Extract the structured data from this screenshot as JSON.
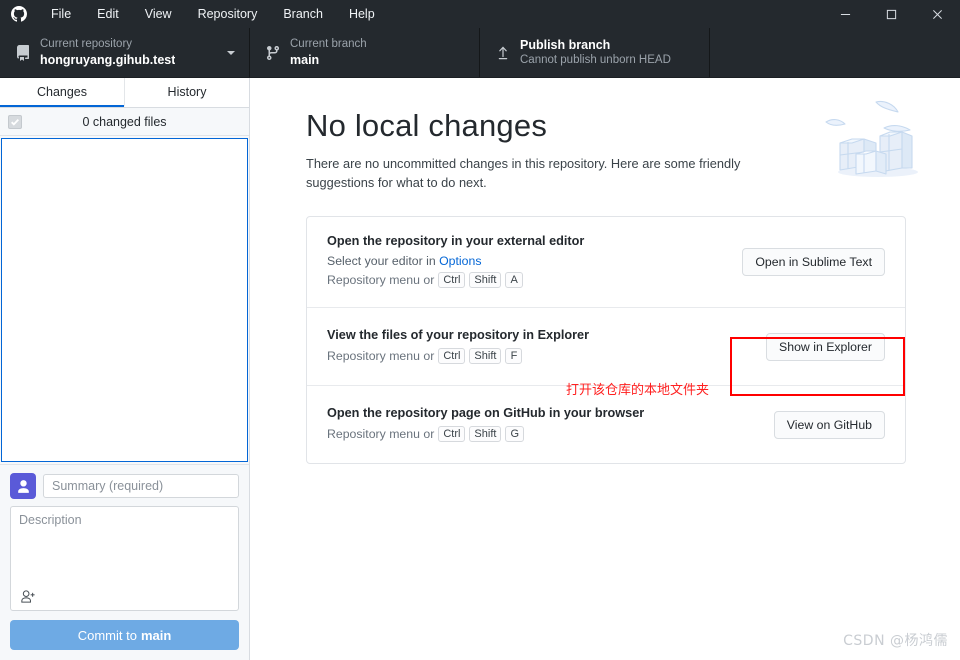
{
  "window": {
    "menu": [
      "File",
      "Edit",
      "View",
      "Repository",
      "Branch",
      "Help"
    ],
    "controls": {
      "minimize": "minimize",
      "maximize": "maximize",
      "close": "close"
    }
  },
  "toolbar": {
    "repository": {
      "label": "Current repository",
      "value": "hongruyang.gihub.test"
    },
    "branch": {
      "label": "Current branch",
      "value": "main"
    },
    "publish": {
      "title": "Publish branch",
      "subtitle": "Cannot publish unborn HEAD"
    }
  },
  "sidebar": {
    "tabs": [
      {
        "label": "Changes",
        "active": true
      },
      {
        "label": "History",
        "active": false
      }
    ],
    "changed_files": "0 changed files",
    "commit": {
      "summary_placeholder": "Summary (required)",
      "summary_value": "",
      "description_placeholder": "Description",
      "description_value": "",
      "button_prefix": "Commit to ",
      "button_branch": "main"
    }
  },
  "main": {
    "title": "No local changes",
    "subtitle": "There are no uncommitted changes in this repository. Here are some friendly suggestions for what to do next.",
    "cards": [
      {
        "title": "Open the repository in your external editor",
        "desc_prefix": "Select your editor in ",
        "desc_link": "Options",
        "menu_prefix": "Repository menu or",
        "keys": [
          "Ctrl",
          "Shift",
          "A"
        ],
        "action": "Open in Sublime Text"
      },
      {
        "title": "View the files of your repository in Explorer",
        "desc_prefix": "",
        "desc_link": "",
        "menu_prefix": "Repository menu or",
        "keys": [
          "Ctrl",
          "Shift",
          "F"
        ],
        "action": "Show in Explorer"
      },
      {
        "title": "Open the repository page on GitHub in your browser",
        "desc_prefix": "",
        "desc_link": "",
        "menu_prefix": "Repository menu or",
        "keys": [
          "Ctrl",
          "Shift",
          "G"
        ],
        "action": "View on GitHub"
      }
    ]
  },
  "annotation": {
    "text": "打开该仓库的本地文件夹",
    "color": "#ff0000"
  },
  "watermark": "CSDN @杨鸿儒",
  "colors": {
    "titlebar": "#24292e",
    "accent": "#0366d6",
    "commit_button": "#6eaae4",
    "annotation": "#ff0000"
  }
}
